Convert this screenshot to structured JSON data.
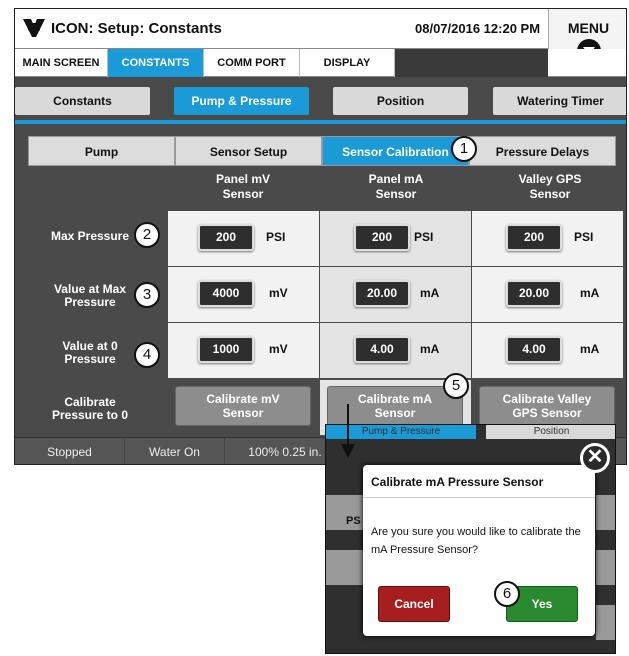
{
  "header": {
    "title": "ICON: Setup: Constants",
    "datetime": "08/07/2016 12:20 PM",
    "menu_label": "MENU"
  },
  "topnav": {
    "tabs": [
      {
        "label": "MAIN SCREEN",
        "active": false
      },
      {
        "label": "CONSTANTS",
        "active": true
      },
      {
        "label": "COMM PORT",
        "active": false
      },
      {
        "label": "DISPLAY",
        "active": false
      }
    ]
  },
  "subtabs": [
    {
      "label": "Constants",
      "active": false
    },
    {
      "label": "Pump & Pressure",
      "active": true
    },
    {
      "label": "Position",
      "active": false
    },
    {
      "label": "Watering Timer",
      "active": false
    }
  ],
  "section_tabs": [
    {
      "label": "Pump",
      "active": false
    },
    {
      "label": "Sensor Setup",
      "active": false
    },
    {
      "label": "Sensor Calibration",
      "active": true
    },
    {
      "label": "Pressure Delays",
      "active": false
    }
  ],
  "columns": [
    {
      "line1": "Panel mV",
      "line2": "Sensor"
    },
    {
      "line1": "Panel mA",
      "line2": "Sensor"
    },
    {
      "line1": "Valley GPS",
      "line2": "Sensor"
    }
  ],
  "rows": {
    "max_pressure": {
      "label": "Max Pressure",
      "cells": [
        {
          "value": "200",
          "unit": "PSI"
        },
        {
          "value": "200",
          "unit": "PSI"
        },
        {
          "value": "200",
          "unit": "PSI"
        }
      ]
    },
    "value_at_max": {
      "label_line1": "Value at Max",
      "label_line2": "Pressure",
      "cells": [
        {
          "value": "4000",
          "unit": "mV"
        },
        {
          "value": "20.00",
          "unit": "mA"
        },
        {
          "value": "20.00",
          "unit": "mA"
        }
      ]
    },
    "value_at_zero": {
      "label_line1": "Value at 0",
      "label_line2": "Pressure",
      "cells": [
        {
          "value": "1000",
          "unit": "mV"
        },
        {
          "value": "4.00",
          "unit": "mA"
        },
        {
          "value": "4.00",
          "unit": "mA"
        }
      ]
    },
    "calibrate": {
      "label_line1": "Calibrate",
      "label_line2": "Pressure to 0",
      "buttons": [
        {
          "line1": "Calibrate mV",
          "line2": "Sensor"
        },
        {
          "line1": "Calibrate mA",
          "line2": "Sensor"
        },
        {
          "line1": "Calibrate Valley",
          "line2": "GPS Sensor"
        }
      ]
    }
  },
  "statusbar": {
    "status": "Stopped",
    "water": "Water On",
    "speed": "100%  0.25 in."
  },
  "callouts": [
    "1",
    "2",
    "3",
    "4",
    "5",
    "6"
  ],
  "dialog": {
    "bg_tab_left": "Pump & Pressure",
    "bg_tab_right": "Position",
    "bg_side_text": "PS",
    "title": "Calibrate mA Pressure Sensor",
    "message": "Are you sure you would like to calibrate the mA Pressure Sensor?",
    "cancel_label": "Cancel",
    "yes_label": "Yes",
    "close_glyph": "✕"
  },
  "colors": {
    "accent_blue": "#1a9ad6",
    "panel_dark": "#4a4a4a",
    "cancel_red": "#a61e1e",
    "yes_green": "#2a8a30"
  },
  "icons": {
    "logo": "valley-logo-icon",
    "menu": "chevron-down-icon",
    "close": "close-icon",
    "arrow": "down-arrow-icon"
  }
}
